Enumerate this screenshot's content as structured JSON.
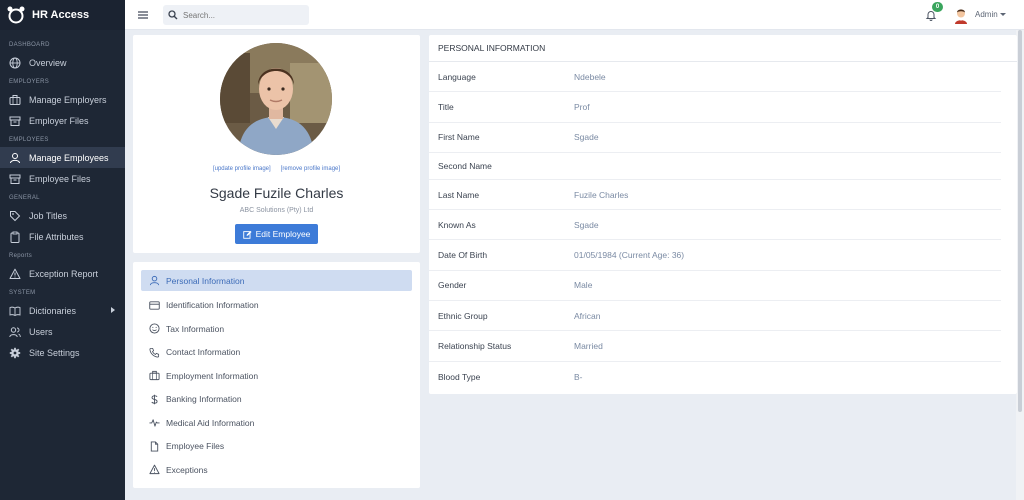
{
  "app": {
    "title": "HR Access"
  },
  "sidebar": {
    "sections": [
      {
        "label": "DASHBOARD",
        "items": [
          {
            "label": "Overview",
            "icon": "globe-icon"
          }
        ]
      },
      {
        "label": "EMPLOYERS",
        "items": [
          {
            "label": "Manage Employers",
            "icon": "briefcase-icon"
          },
          {
            "label": "Employer Files",
            "icon": "archive-icon"
          }
        ]
      },
      {
        "label": "EMPLOYEES",
        "items": [
          {
            "label": "Manage Employees",
            "icon": "user-icon",
            "active": true
          },
          {
            "label": "Employee Files",
            "icon": "archive-icon"
          }
        ]
      },
      {
        "label": "GENERAL",
        "items": [
          {
            "label": "Job Titles",
            "icon": "tag-icon"
          },
          {
            "label": "File Attributes",
            "icon": "clipboard-icon"
          }
        ]
      },
      {
        "label": "Reports",
        "items": [
          {
            "label": "Exception Report",
            "icon": "warning-icon"
          }
        ]
      },
      {
        "label": "SYSTEM",
        "items": [
          {
            "label": "Dictionaries",
            "icon": "book-icon"
          },
          {
            "label": "Users",
            "icon": "users-icon"
          },
          {
            "label": "Site Settings",
            "icon": "gear-icon"
          }
        ]
      }
    ]
  },
  "topbar": {
    "search_placeholder": "Search...",
    "notification_count": "0",
    "user_label": "Admin"
  },
  "profile": {
    "update_link": "[update profile image]",
    "remove_link": "[remove profile image]",
    "name": "Sgade Fuzile Charles",
    "company": "ABC Solutions (Pty) Ltd",
    "edit_button": "Edit Employee"
  },
  "menu": [
    {
      "label": "Personal Information",
      "icon": "user-icon",
      "active": true
    },
    {
      "label": "Identification Information",
      "icon": "id-card-icon"
    },
    {
      "label": "Tax Information",
      "icon": "smile-icon"
    },
    {
      "label": "Contact Information",
      "icon": "phone-icon"
    },
    {
      "label": "Employment Information",
      "icon": "briefcase-icon"
    },
    {
      "label": "Banking Information",
      "icon": "dollar-icon"
    },
    {
      "label": "Medical Aid Information",
      "icon": "pulse-icon"
    },
    {
      "label": "Employee Files",
      "icon": "file-icon"
    },
    {
      "label": "Exceptions",
      "icon": "warning-icon"
    }
  ],
  "info": {
    "title": "PERSONAL INFORMATION",
    "rows": [
      {
        "label": "Language",
        "value": "Ndebele"
      },
      {
        "label": "Title",
        "value": "Prof"
      },
      {
        "label": "First Name",
        "value": "Sgade"
      },
      {
        "label": "Second Name",
        "value": ""
      },
      {
        "label": "Last Name",
        "value": "Fuzile Charles"
      },
      {
        "label": "Known As",
        "value": "Sgade"
      },
      {
        "label": "Date Of Birth",
        "value": "01/05/1984 (Current Age: 36)"
      },
      {
        "label": "Gender",
        "value": "Male"
      },
      {
        "label": "Ethnic Group",
        "value": "African"
      },
      {
        "label": "Relationship Status",
        "value": "Married"
      },
      {
        "label": "Blood Type",
        "value": "B-"
      }
    ]
  }
}
